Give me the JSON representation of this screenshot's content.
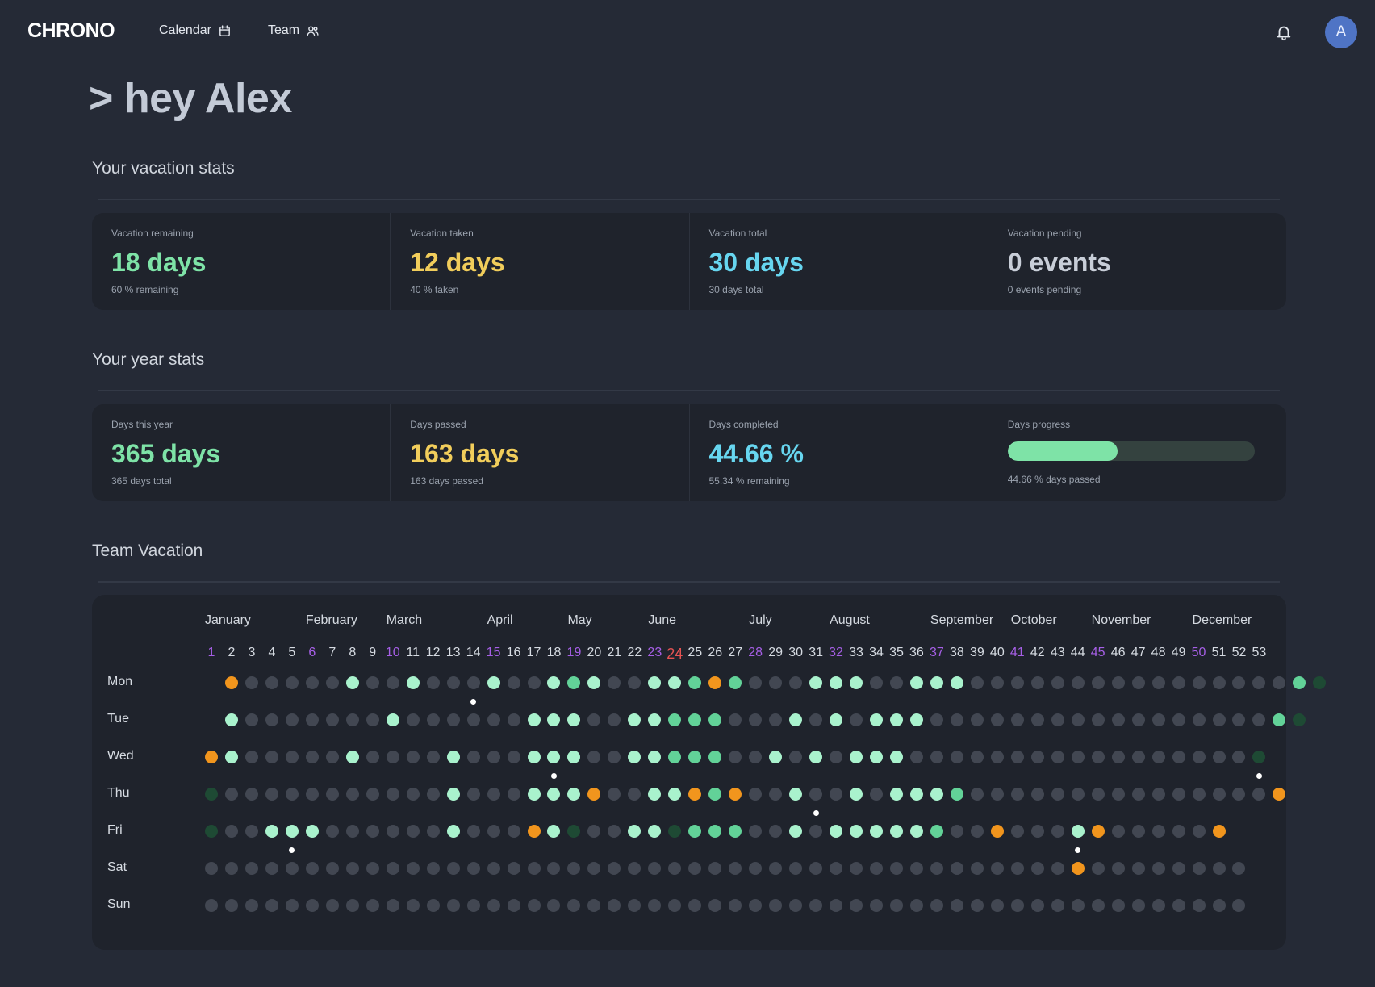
{
  "nav": {
    "logo": "CHRONO",
    "items": [
      {
        "label": "Calendar",
        "icon": "calendar-icon"
      },
      {
        "label": "Team",
        "icon": "team-icon"
      }
    ],
    "notification_icon": "bell-icon",
    "avatar_initial": "A"
  },
  "greeting": "> hey Alex",
  "vacation_stats": {
    "title": "Your vacation stats",
    "items": [
      {
        "label": "Vacation remaining",
        "value": "18 days",
        "sub": "60 % remaining",
        "color": "#7ee3a7"
      },
      {
        "label": "Vacation taken",
        "value": "12 days",
        "sub": "40 % taken",
        "color": "#f1cd5b"
      },
      {
        "label": "Vacation total",
        "value": "30 days",
        "sub": "30 days total",
        "color": "#67d6f0"
      },
      {
        "label": "Vacation pending",
        "value": "0 events",
        "sub": "0 events pending",
        "color": "#c8ced8"
      }
    ]
  },
  "year_stats": {
    "title": "Your year stats",
    "items": [
      {
        "label": "Days this year",
        "value": "365 days",
        "sub": "365 days total"
      },
      {
        "label": "Days passed",
        "value": "163 days",
        "sub": "163 days passed"
      },
      {
        "label": "Days completed",
        "value": "44.66 %",
        "sub": "55.34 % remaining"
      },
      {
        "label": "Days progress",
        "progress": 0.4466,
        "sub": "44.66 % days passed"
      }
    ]
  },
  "team_vacation": {
    "title": "Team Vacation",
    "months": [
      "January",
      "February",
      "March",
      "April",
      "May",
      "June",
      "July",
      "August",
      "September",
      "October",
      "November",
      "December"
    ],
    "month_start_weeks": [
      1,
      6,
      10,
      15,
      19,
      23,
      28,
      32,
      37,
      41,
      45,
      50
    ],
    "weeks": [
      "1",
      "2",
      "3",
      "4",
      "5",
      "6",
      "7",
      "8",
      "9",
      "10",
      "11",
      "12",
      "13",
      "14",
      "15",
      "16",
      "17",
      "18",
      "19",
      "20",
      "21",
      "22",
      "23",
      "24",
      "25",
      "26",
      "27",
      "28",
      "29",
      "30",
      "31",
      "32",
      "33",
      "34",
      "35",
      "36",
      "37",
      "38",
      "39",
      "40",
      "41",
      "42",
      "43",
      "44",
      "45",
      "46",
      "47",
      "48",
      "49",
      "50",
      "51",
      "52",
      "53"
    ],
    "purple_weeks": [
      1,
      6,
      10,
      15,
      19,
      23,
      28,
      32,
      37,
      41,
      45,
      50
    ],
    "current_week": 24,
    "days": [
      "Mon",
      "Tue",
      "Wed",
      "Thu",
      "Fri",
      "Sat",
      "Sun"
    ],
    "legend_colors": {
      "none": "#424752",
      "c1": "#a9f2cd",
      "c2": "#62d298",
      "c3": "#2b8a57",
      "c4": "#1e4a34",
      "o": "#f1951d"
    },
    "grid": [
      "-o00000100100010012100112o200011100111000000000000000024",
      "-100000001000000111001122200010101110000000000000000024",
      "o1000001000010001110011222001010111000000000000000004",
      "4000000000001000111o0011o2o00100101112000000000000000o",
      "4001110000001000o1400114222001011111200o0001o00000o",
      "0000000000000000000000000000000000000000000o00000000",
      "0000000000000000000000000000000000000000000000000000"
    ],
    "markers": [
      [
        0,
        14
      ],
      [
        2,
        18
      ],
      [
        2,
        53
      ],
      [
        3,
        31
      ],
      [
        4,
        5
      ],
      [
        4,
        44
      ]
    ]
  }
}
